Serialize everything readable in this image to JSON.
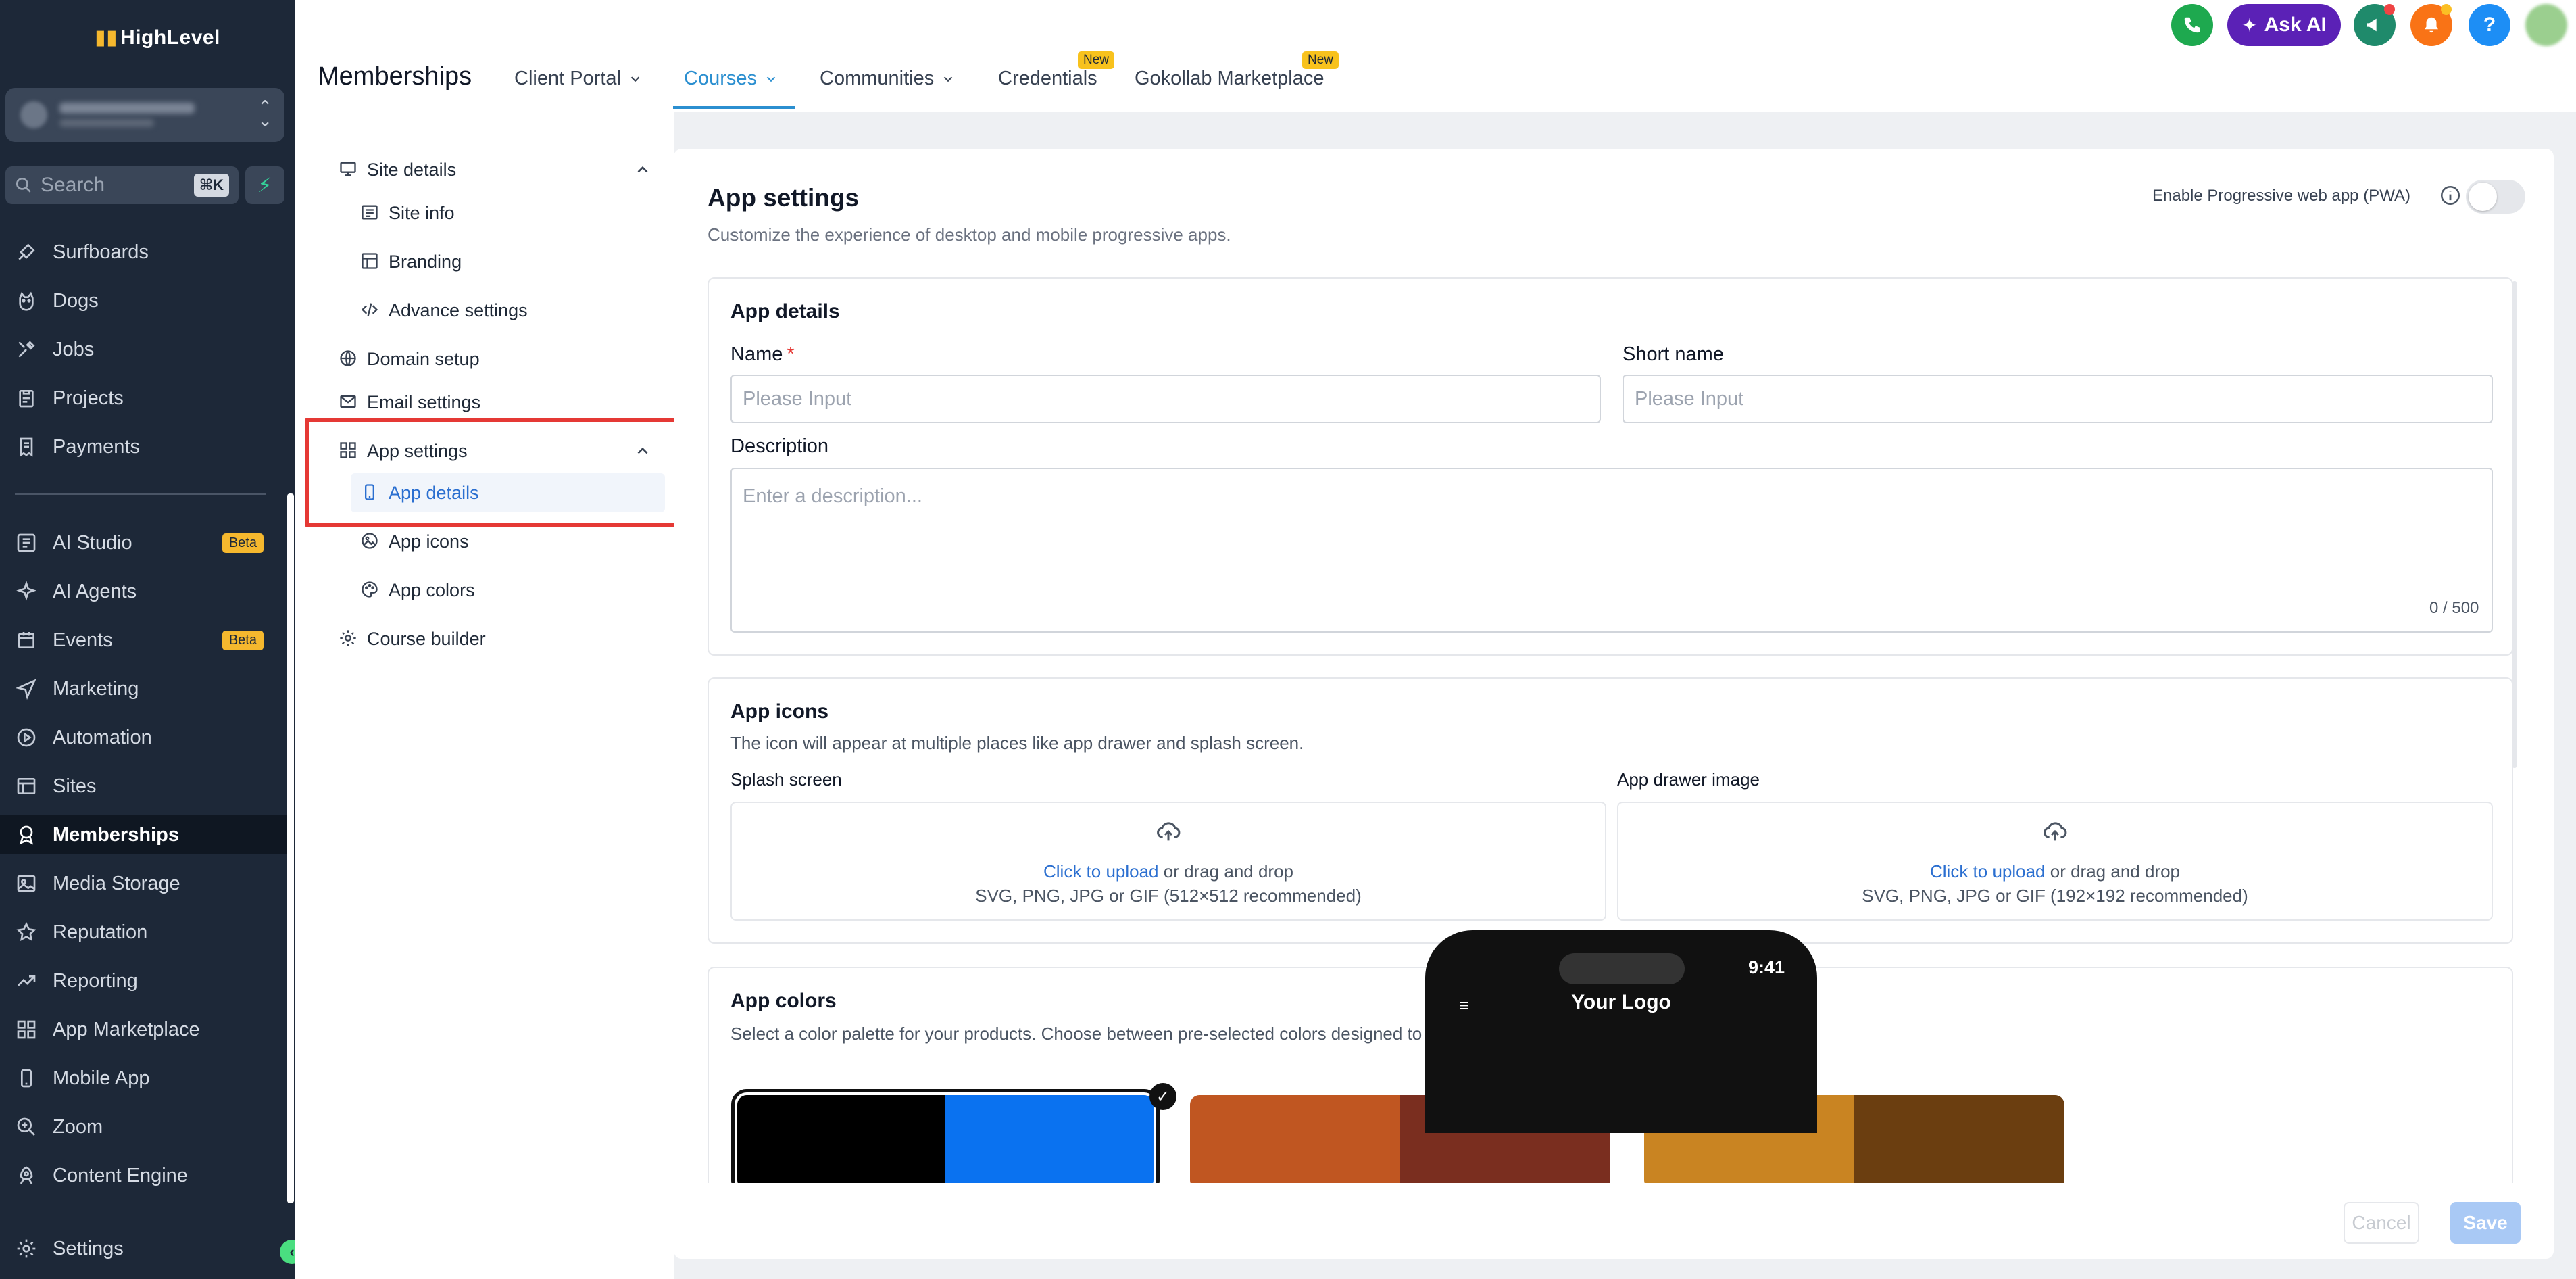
{
  "app": {
    "logo_text": "HighLevel"
  },
  "search": {
    "label": "Search",
    "shortcut": "⌘K"
  },
  "nav": {
    "items": [
      {
        "label": "Surfboards",
        "icon": "paint-icon"
      },
      {
        "label": "Dogs",
        "icon": "dog-icon"
      },
      {
        "label": "Jobs",
        "icon": "tools-icon"
      },
      {
        "label": "Projects",
        "icon": "clipboard-icon"
      },
      {
        "label": "Payments",
        "icon": "receipt-icon"
      },
      {
        "label": "AI Studio",
        "icon": "layers-icon",
        "badge": "Beta"
      },
      {
        "label": "AI Agents",
        "icon": "sparkle-icon"
      },
      {
        "label": "Events",
        "icon": "calendar-icon",
        "badge": "Beta"
      },
      {
        "label": "Marketing",
        "icon": "send-icon"
      },
      {
        "label": "Automation",
        "icon": "play-circle-icon"
      },
      {
        "label": "Sites",
        "icon": "window-icon"
      },
      {
        "label": "Memberships",
        "icon": "award-icon",
        "active": true
      },
      {
        "label": "Media Storage",
        "icon": "image-icon"
      },
      {
        "label": "Reputation",
        "icon": "star-icon"
      },
      {
        "label": "Reporting",
        "icon": "trend-icon"
      },
      {
        "label": "App Marketplace",
        "icon": "grid-icon"
      },
      {
        "label": "Mobile App",
        "icon": "phone-icon"
      },
      {
        "label": "Zoom",
        "icon": "zoom-icon"
      },
      {
        "label": "Content Engine",
        "icon": "rocket-icon"
      }
    ],
    "settings_label": "Settings"
  },
  "header": {
    "title": "Memberships",
    "tabs": [
      {
        "label": "Client Portal",
        "has_chevron": true
      },
      {
        "label": "Courses",
        "has_chevron": true,
        "active": true
      },
      {
        "label": "Communities",
        "has_chevron": true
      },
      {
        "label": "Credentials",
        "badge": "New"
      },
      {
        "label": "Gokollab Marketplace",
        "badge": "New"
      }
    ],
    "ask_ai_label": "Ask AI",
    "help_label": "?",
    "colors": {
      "phone": "#1ea94f",
      "ask_ai": "#5b21b6",
      "megaphone": "#1f8a6b",
      "bell": "#f97316",
      "help": "#1d8ef5"
    }
  },
  "subnav": {
    "site_details": "Site details",
    "site_info": "Site info",
    "branding": "Branding",
    "advance_settings": "Advance settings",
    "domain_setup": "Domain setup",
    "email_settings": "Email settings",
    "app_settings": "App settings",
    "app_details": "App details",
    "app_icons": "App icons",
    "app_colors": "App colors",
    "course_builder": "Course builder"
  },
  "main": {
    "title": "App settings",
    "subtitle": "Customize the experience of desktop and mobile progressive apps.",
    "pwa_label": "Enable Progressive web app (PWA)",
    "pwa_enabled": false,
    "app_details": {
      "title": "App details",
      "name_label": "Name",
      "name_required": "*",
      "name_placeholder": "Please Input",
      "short_name_label": "Short name",
      "short_name_placeholder": "Please Input",
      "description_label": "Description",
      "description_placeholder": "Enter a description...",
      "description_counter": "0 / 500"
    },
    "app_icons": {
      "title": "App icons",
      "subtitle": "The icon will appear at multiple places like app drawer and splash screen.",
      "splash_label": "Splash screen",
      "drawer_label": "App drawer image",
      "upload_link": "Click to upload",
      "upload_rest": " or drag and drop",
      "splash_hint": "SVG, PNG, JPG or GIF (512×512 recommended)",
      "drawer_hint": "SVG, PNG, JPG or GIF (192×192 recommended)"
    },
    "app_colors": {
      "title": "App colors",
      "subtitle": "Select a color palette for your products. Choose between pre-selected colors designed to give you branding flexibility.",
      "palettes": [
        {
          "colors": [
            "#000000",
            "#0a72f0"
          ],
          "selected": true
        },
        {
          "colors": [
            "#c05621",
            "#7a2e1f"
          ]
        },
        {
          "colors": [
            "#c98422",
            "#6b3e10"
          ]
        }
      ],
      "preview": {
        "time": "9:41",
        "logo_text": "Your Logo"
      }
    },
    "cancel_label": "Cancel",
    "save_label": "Save"
  }
}
